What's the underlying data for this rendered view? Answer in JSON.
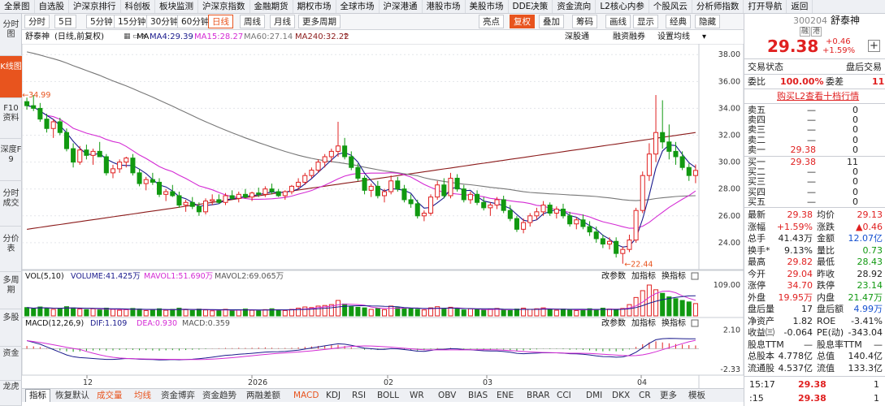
{
  "menu": [
    "全景图",
    "自选股",
    "沪深京排行",
    "科创板",
    "板块监测",
    "沪深京指数",
    "金融期货",
    "期权市场",
    "全球市场",
    "沪深港通",
    "港股市场",
    "美股市场",
    "DDE决策",
    "资金流向",
    "L2核心内参",
    "个股风云",
    "分析师指数",
    "打开导航",
    "返回"
  ],
  "left_tabs": [
    "分时图",
    "K线图",
    "F10资料",
    "深度F9",
    "分时成交",
    "分价表",
    "多周期",
    "多股",
    "资金",
    "龙虎"
  ],
  "periods": [
    "分时",
    "5日",
    "5分钟",
    "15分钟",
    "30分钟",
    "60分钟",
    "日线",
    "周线",
    "月线",
    "更多周期"
  ],
  "tools": [
    "亮点",
    "复权",
    "叠加",
    "筹码",
    "画线",
    "显示",
    "经典",
    "隐藏"
  ],
  "info": {
    "name": "舒泰神",
    "mode": "(日线,前复权)",
    "ma_label": "MA",
    "ma4": "MA4:29.39",
    "ma15": "MA15:28.27",
    "ma60": "MA60:27.14",
    "ma240": "MA240:32.22",
    "links": [
      "深股通",
      "融资融券",
      "设置均线"
    ]
  },
  "vol_line": {
    "label": "VOL(5,10)",
    "volume": "VOLUME:41.425万",
    "mavol1": "MAVOL1:51.690万",
    "mavol2": "MAVOL2:69.065万",
    "buttons": [
      "改参数",
      "加指标",
      "换指标"
    ]
  },
  "macd_line": {
    "label": "MACD(12,26,9)",
    "dif": "DIF:1.109",
    "dea": "DEA:0.930",
    "macd": "MACD:0.359",
    "buttons": [
      "改参数",
      "加指标",
      "换指标"
    ]
  },
  "bottom_tabs": [
    "指标",
    "恢复默认",
    "成交量",
    "均线",
    "资金博弈",
    "资金趋势",
    "两融差额",
    "MACD",
    "KDJ",
    "RSI",
    "BOLL",
    "WR",
    "OBV",
    "BIAS",
    "ENE",
    "BRAR",
    "CCI",
    "DMI",
    "DKX",
    "CR",
    "更多",
    "模板"
  ],
  "annotations": {
    "high": "34.99",
    "low": "22.44"
  },
  "x_labels": [
    "12",
    "2026",
    "02",
    "03",
    "04"
  ],
  "chart_data": [
    {
      "type": "candlestick",
      "y_ticks": [
        "38.00",
        "36.00",
        "34.00",
        "32.00",
        "30.00",
        "28.00",
        "26.00",
        "24.00"
      ],
      "ylim": [
        22.0,
        38.8
      ],
      "ohlc": [
        [
          34.5,
          34.8,
          33.9,
          34.2
        ],
        [
          34.2,
          34.99,
          33.8,
          34.0
        ],
        [
          34.0,
          34.4,
          33.0,
          33.2
        ],
        [
          33.2,
          33.6,
          32.2,
          32.5
        ],
        [
          32.5,
          33.2,
          31.8,
          33.0
        ],
        [
          33.0,
          33.3,
          32.0,
          32.2
        ],
        [
          32.2,
          32.5,
          30.8,
          31.0
        ],
        [
          31.0,
          31.4,
          29.6,
          30.0
        ],
        [
          30.0,
          31.2,
          29.8,
          30.9
        ],
        [
          30.9,
          31.3,
          30.2,
          30.5
        ],
        [
          30.5,
          31.0,
          29.8,
          30.8
        ],
        [
          30.8,
          31.5,
          30.4,
          30.4
        ],
        [
          30.4,
          30.6,
          29.0,
          29.2
        ],
        [
          29.2,
          29.8,
          28.8,
          29.5
        ],
        [
          29.5,
          30.2,
          29.2,
          30.0
        ],
        [
          30.0,
          30.4,
          29.6,
          30.3
        ],
        [
          30.3,
          30.6,
          29.0,
          29.2
        ],
        [
          29.2,
          29.5,
          28.2,
          28.4
        ],
        [
          28.4,
          28.9,
          27.9,
          28.7
        ],
        [
          28.7,
          29.2,
          28.3,
          28.5
        ],
        [
          28.5,
          28.8,
          27.4,
          27.6
        ],
        [
          27.6,
          28.0,
          27.1,
          27.8
        ],
        [
          27.8,
          28.3,
          27.4,
          27.5
        ],
        [
          27.5,
          27.8,
          26.6,
          26.8
        ],
        [
          26.8,
          27.2,
          26.3,
          27.0
        ],
        [
          27.0,
          27.4,
          26.5,
          26.7
        ],
        [
          26.7,
          27.0,
          26.0,
          26.3
        ],
        [
          26.3,
          27.3,
          26.1,
          27.1
        ],
        [
          27.1,
          27.6,
          26.8,
          27.2
        ],
        [
          27.2,
          27.6,
          26.9,
          27.0
        ],
        [
          27.0,
          27.7,
          26.8,
          27.5
        ],
        [
          27.5,
          27.9,
          27.2,
          27.3
        ],
        [
          27.3,
          27.8,
          27.0,
          27.6
        ],
        [
          27.6,
          28.0,
          27.3,
          27.4
        ],
        [
          27.4,
          27.8,
          27.1,
          27.7
        ],
        [
          27.7,
          28.1,
          27.4,
          27.6
        ],
        [
          27.6,
          28.2,
          27.4,
          28.0
        ],
        [
          28.0,
          28.4,
          27.6,
          27.8
        ],
        [
          27.8,
          28.0,
          27.4,
          27.5
        ],
        [
          27.5,
          27.9,
          27.2,
          27.8
        ],
        [
          27.8,
          28.3,
          27.6,
          28.2
        ],
        [
          28.2,
          28.8,
          28.0,
          28.5
        ],
        [
          28.5,
          29.2,
          28.3,
          29.0
        ],
        [
          29.0,
          29.6,
          28.8,
          29.4
        ],
        [
          29.4,
          30.2,
          29.2,
          30.0
        ],
        [
          30.0,
          30.6,
          29.6,
          30.4
        ],
        [
          30.4,
          31.0,
          30.0,
          30.8
        ],
        [
          30.8,
          33.0,
          30.4,
          31.2
        ],
        [
          31.2,
          31.8,
          30.2,
          30.4
        ],
        [
          30.4,
          30.8,
          29.4,
          29.6
        ],
        [
          29.6,
          29.9,
          28.6,
          28.8
        ],
        [
          28.8,
          29.0,
          27.6,
          27.9
        ],
        [
          27.9,
          28.4,
          27.4,
          28.2
        ],
        [
          28.2,
          28.6,
          27.3,
          27.5
        ],
        [
          27.5,
          28.0,
          27.0,
          27.8
        ],
        [
          27.8,
          29.0,
          27.6,
          28.6
        ],
        [
          28.6,
          28.9,
          27.8,
          28.0
        ],
        [
          28.0,
          28.3,
          27.0,
          27.2
        ],
        [
          27.2,
          27.6,
          26.6,
          26.9
        ],
        [
          26.9,
          27.2,
          25.8,
          26.0
        ],
        [
          26.0,
          26.4,
          25.6,
          26.2
        ],
        [
          26.2,
          27.6,
          26.0,
          27.4
        ],
        [
          27.4,
          28.6,
          27.2,
          28.3
        ],
        [
          28.3,
          28.8,
          27.3,
          27.5
        ],
        [
          27.5,
          29.2,
          27.3,
          28.8
        ],
        [
          28.8,
          29.1,
          27.8,
          28.0
        ],
        [
          28.0,
          28.3,
          27.0,
          27.2
        ],
        [
          27.2,
          27.8,
          26.9,
          27.6
        ],
        [
          27.6,
          27.9,
          26.8,
          27.0
        ],
        [
          27.0,
          27.4,
          26.4,
          26.6
        ],
        [
          26.6,
          27.0,
          26.0,
          26.8
        ],
        [
          26.8,
          27.4,
          26.5,
          27.2
        ],
        [
          27.2,
          27.5,
          26.2,
          26.4
        ],
        [
          26.4,
          26.8,
          25.6,
          25.8
        ],
        [
          25.8,
          26.0,
          24.8,
          25.0
        ],
        [
          25.0,
          25.8,
          24.7,
          25.5
        ],
        [
          25.5,
          26.2,
          25.2,
          26.0
        ],
        [
          26.0,
          26.6,
          25.7,
          26.3
        ],
        [
          26.3,
          27.1,
          26.0,
          26.8
        ],
        [
          26.8,
          27.0,
          26.0,
          26.2
        ],
        [
          26.2,
          26.7,
          25.8,
          26.5
        ],
        [
          26.5,
          26.9,
          25.8,
          26.0
        ],
        [
          26.0,
          26.3,
          25.2,
          25.4
        ],
        [
          25.4,
          25.9,
          25.0,
          25.7
        ],
        [
          25.7,
          26.1,
          25.0,
          25.2
        ],
        [
          25.2,
          25.6,
          24.5,
          24.8
        ],
        [
          24.8,
          25.2,
          24.0,
          24.3
        ],
        [
          24.3,
          24.6,
          23.6,
          23.9
        ],
        [
          23.9,
          24.4,
          23.5,
          24.1
        ],
        [
          24.1,
          24.4,
          22.9,
          23.2
        ],
        [
          23.2,
          23.7,
          22.44,
          23.5
        ],
        [
          23.5,
          24.6,
          23.3,
          24.2
        ],
        [
          24.2,
          26.6,
          24.0,
          26.4
        ],
        [
          26.4,
          29.3,
          26.2,
          29.0
        ],
        [
          29.0,
          31.4,
          28.6,
          30.6
        ],
        [
          30.6,
          34.99,
          30.0,
          32.2
        ],
        [
          32.2,
          34.6,
          31.0,
          31.5
        ],
        [
          31.5,
          32.8,
          30.2,
          30.8
        ],
        [
          30.8,
          31.5,
          29.8,
          30.4
        ],
        [
          30.4,
          30.8,
          29.4,
          29.6
        ],
        [
          29.6,
          29.9,
          28.6,
          29.0
        ],
        [
          29.0,
          29.82,
          28.43,
          29.38
        ]
      ],
      "ma_series": [
        {
          "name": "MA4",
          "color": "#1a1a8c"
        },
        {
          "name": "MA15",
          "color": "#d42bd4"
        },
        {
          "name": "MA60",
          "color": "#777777"
        },
        {
          "name": "MA240",
          "color": "#8b1a1a"
        }
      ]
    },
    {
      "type": "bar",
      "name": "VOL",
      "y_ticks": [
        "109.00"
      ],
      "ylim": [
        0,
        115
      ],
      "values": [
        28,
        24,
        30,
        26,
        22,
        25,
        31,
        27,
        23,
        21,
        24,
        20,
        26,
        22,
        19,
        21,
        25,
        23,
        18,
        20,
        24,
        19,
        22,
        26,
        21,
        18,
        23,
        20,
        17,
        19,
        22,
        18,
        20,
        23,
        19,
        17,
        21,
        24,
        20,
        18,
        22,
        26,
        30,
        28,
        33,
        35,
        38,
        52,
        40,
        31,
        29,
        27,
        22,
        25,
        21,
        33,
        28,
        24,
        26,
        22,
        20,
        27,
        31,
        25,
        29,
        23,
        20,
        24,
        21,
        19,
        22,
        25,
        20,
        18,
        23,
        26,
        22,
        24,
        27,
        21,
        19,
        23,
        20,
        18,
        22,
        24,
        20,
        26,
        23,
        21,
        25,
        38,
        62,
        85,
        104,
        88,
        76,
        64,
        58,
        52,
        47,
        41.4
      ]
    },
    {
      "type": "bar",
      "name": "MACD",
      "y_ticks": [
        "2.10",
        "-2.33"
      ],
      "ylim": [
        -2.6,
        2.4
      ],
      "values": [
        0.3,
        0.25,
        0.18,
        0.05,
        -0.1,
        -0.2,
        -0.3,
        -0.35,
        -0.3,
        -0.25,
        -0.2,
        -0.18,
        -0.22,
        -0.2,
        -0.15,
        -0.12,
        -0.14,
        -0.18,
        -0.16,
        -0.2,
        -0.22,
        -0.18,
        -0.16,
        -0.2,
        -0.15,
        -0.12,
        -0.1,
        -0.05,
        0.02,
        0.05,
        0.08,
        0.06,
        0.1,
        0.08,
        0.1,
        0.12,
        0.14,
        0.1,
        0.06,
        0.08,
        0.1,
        0.14,
        0.2,
        0.25,
        0.3,
        0.34,
        0.38,
        0.42,
        0.3,
        0.15,
        0.0,
        -0.12,
        -0.1,
        -0.14,
        -0.1,
        0.0,
        -0.05,
        -0.12,
        -0.16,
        -0.22,
        -0.18,
        -0.05,
        0.06,
        0.02,
        0.08,
        0.02,
        -0.06,
        -0.04,
        -0.08,
        -0.12,
        -0.1,
        -0.06,
        -0.1,
        -0.16,
        -0.24,
        -0.2,
        -0.14,
        -0.08,
        -0.02,
        -0.05,
        -0.03,
        -0.06,
        -0.12,
        -0.1,
        -0.14,
        -0.2,
        -0.26,
        -0.3,
        -0.26,
        -0.3,
        -0.24,
        -0.08,
        0.2,
        0.5,
        0.7,
        0.82,
        0.7,
        0.6,
        0.52,
        0.46,
        0.4,
        0.359
      ],
      "dif": [
        0.9,
        0.7,
        0.5,
        0.2,
        -0.1,
        -0.4,
        -0.7,
        -0.9,
        -1.0,
        -1.05,
        -1.1,
        -1.15,
        -1.2,
        -1.2,
        -1.15,
        -1.1,
        -1.12,
        -1.18,
        -1.2,
        -1.22,
        -1.26,
        -1.25,
        -1.22,
        -1.25,
        -1.22,
        -1.18,
        -1.12,
        -1.05,
        -0.95,
        -0.85,
        -0.75,
        -0.7,
        -0.62,
        -0.58,
        -0.52,
        -0.45,
        -0.38,
        -0.35,
        -0.34,
        -0.3,
        -0.24,
        -0.16,
        -0.05,
        0.08,
        0.2,
        0.32,
        0.44,
        0.55,
        0.5,
        0.38,
        0.22,
        0.06,
        0.0,
        -0.08,
        -0.08,
        0.0,
        -0.02,
        -0.1,
        -0.18,
        -0.28,
        -0.3,
        -0.2,
        -0.08,
        -0.08,
        0.0,
        -0.02,
        -0.1,
        -0.12,
        -0.18,
        -0.24,
        -0.26,
        -0.26,
        -0.32,
        -0.4,
        -0.52,
        -0.56,
        -0.54,
        -0.5,
        -0.45,
        -0.46,
        -0.46,
        -0.5,
        -0.56,
        -0.58,
        -0.62,
        -0.7,
        -0.8,
        -0.88,
        -0.9,
        -0.95,
        -0.92,
        -0.75,
        -0.4,
        0.1,
        0.6,
        1.0,
        1.12,
        1.15,
        1.14,
        1.12,
        1.11,
        1.109
      ]
    }
  ],
  "panel": {
    "code": "300204",
    "name": "舒泰神",
    "tags": [
      "融",
      "港"
    ],
    "price": "29.38",
    "change": "+0.46",
    "change_pct": "+1.59%",
    "plus_btn": "+",
    "trade_status_label": "交易状态",
    "trade_status": "盘后交易",
    "weibi_label": "委比",
    "weibi": "100.00%",
    "weicha_label": "委差",
    "weicha": "11",
    "buy_l2": "购买L2查看十档行情",
    "sells": [
      {
        "label": "卖五",
        "price": "—",
        "vol": "0"
      },
      {
        "label": "卖四",
        "price": "—",
        "vol": "0"
      },
      {
        "label": "卖三",
        "price": "—",
        "vol": "0"
      },
      {
        "label": "卖二",
        "price": "—",
        "vol": "0"
      },
      {
        "label": "卖一",
        "price": "29.38",
        "vol": "0"
      }
    ],
    "buys": [
      {
        "label": "买一",
        "price": "29.38",
        "vol": "11"
      },
      {
        "label": "买二",
        "price": "—",
        "vol": "0"
      },
      {
        "label": "买三",
        "price": "—",
        "vol": "0"
      },
      {
        "label": "买四",
        "price": "—",
        "vol": "0"
      },
      {
        "label": "买五",
        "price": "—",
        "vol": "0"
      }
    ],
    "stats": [
      {
        "l1": "最新",
        "v1": "29.38",
        "c1": "r",
        "l2": "均价",
        "v2": "29.13",
        "c2": "r"
      },
      {
        "l1": "涨幅",
        "v1": "+1.59%",
        "c1": "r",
        "l2": "涨跌",
        "v2": "▲0.46",
        "c2": "r"
      },
      {
        "l1": "总手",
        "v1": "41.43万",
        "c1": "",
        "l2": "金额",
        "v2": "12.07亿",
        "c2": "b"
      },
      {
        "l1": "换手*",
        "v1": "9.13%",
        "c1": "",
        "l2": "量比",
        "v2": "0.73",
        "c2": "g"
      },
      {
        "l1": "最高",
        "v1": "29.82",
        "c1": "r",
        "l2": "最低",
        "v2": "28.43",
        "c2": "g"
      },
      {
        "l1": "今开",
        "v1": "29.04",
        "c1": "r",
        "l2": "昨收",
        "v2": "28.92",
        "c2": ""
      },
      {
        "l1": "涨停",
        "v1": "34.70",
        "c1": "r",
        "l2": "跌停",
        "v2": "23.14",
        "c2": "g"
      },
      {
        "l1": "外盘",
        "v1": "19.95万",
        "c1": "r",
        "l2": "内盘",
        "v2": "21.47万",
        "c2": "g"
      },
      {
        "l1": "盘后量",
        "v1": "17",
        "c1": "",
        "l2": "盘后额",
        "v2": "4.99万",
        "c2": "b"
      },
      {
        "l1": "净资产",
        "v1": "1.82",
        "c1": "",
        "l2": "ROE",
        "v2": "-3.41%",
        "c2": ""
      },
      {
        "l1": "收益㈢",
        "v1": "-0.064",
        "c1": "",
        "l2": "PE(动)",
        "v2": "-343.04",
        "c2": ""
      },
      {
        "l1": "股息TTM",
        "v1": "—",
        "c1": "",
        "l2": "股息率TTM",
        "v2": "—",
        "c2": ""
      },
      {
        "l1": "总股本",
        "v1": "4.778亿",
        "c1": "",
        "l2": "总值",
        "v2": "140.4亿",
        "c2": ""
      },
      {
        "l1": "流通股",
        "v1": "4.537亿",
        "c1": "",
        "l2": "流值",
        "v2": "133.3亿",
        "c2": ""
      }
    ],
    "ticks": [
      {
        "time": "15:17",
        "price": "29.38",
        "vol": "1"
      },
      {
        "time": ":15",
        "price": "29.38",
        "vol": "1"
      }
    ]
  },
  "colors": {
    "up": "#e02020",
    "down": "#119911",
    "accent": "#e8541e",
    "blue": "#1450d0"
  }
}
